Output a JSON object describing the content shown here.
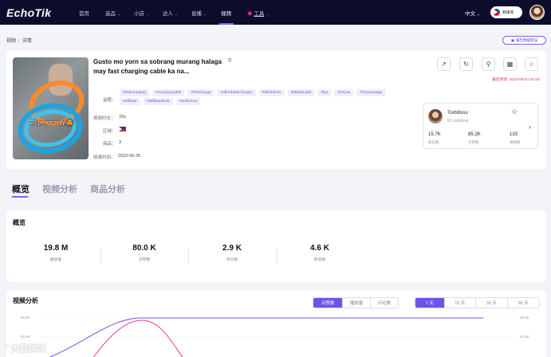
{
  "app": {
    "logo": "EchoTik"
  },
  "nav": {
    "items": [
      {
        "label": "首页"
      },
      {
        "label": "选品",
        "chevron": true
      },
      {
        "label": "小店",
        "chevron": true
      },
      {
        "label": "达人",
        "chevron": true
      },
      {
        "label": "直播",
        "chevron": true
      },
      {
        "label": "视频",
        "active": true
      },
      {
        "label": "工具",
        "chevron": true
      }
    ],
    "language": "中文",
    "country_pill": "菲律宾"
  },
  "breadcrumb": {
    "parent": "视频",
    "current": "详情"
  },
  "report_button": "报告数据错误",
  "video": {
    "title": "Gusto mo yorn sa sobrang murang halaga may fast charging cable ka na...",
    "thumbnail_caption": "20 pesos only!😍",
    "topics_label": "话题：",
    "tags": [
      "#fastcharging",
      "#chargingcable",
      "#fastcharge",
      "#affordablecharger",
      "#tiktokfinds",
      "#tiktokbudol",
      "#fyp",
      "#foryou",
      "#foryourpage",
      "#affiliate",
      "#affiliatetiktok",
      "#ordernow"
    ],
    "duration_label": "视频时长：",
    "duration": "33s",
    "region_label": "区域：",
    "products_label": "商品：",
    "products": "3",
    "collected_label": "收录时间：",
    "collected": "2023-06-25",
    "updated": "最后更新: 2023-08-01 00:00"
  },
  "creator": {
    "name": "Torbitsss",
    "verified_mark": "♡",
    "id": "ID: torbitsss",
    "stats": [
      {
        "value": "15.7K",
        "label": "粉丝数"
      },
      {
        "value": "85.2K",
        "label": "点赞数"
      },
      {
        "value": "133",
        "label": "视频数"
      }
    ]
  },
  "tabs": [
    {
      "label": "概览",
      "active": true
    },
    {
      "label": "视频分析"
    },
    {
      "label": "商品分析"
    }
  ],
  "overview": {
    "title": "概览",
    "metrics": [
      {
        "value": "19.8 M",
        "label": "播放量"
      },
      {
        "value": "80.0 K",
        "label": "点赞数"
      },
      {
        "value": "2.9 K",
        "label": "评论数"
      },
      {
        "value": "4.6 K",
        "label": "转发数"
      }
    ]
  },
  "analysis": {
    "title": "视频分析",
    "metric_tabs": [
      "点赞数",
      "播放量",
      "评论数"
    ],
    "metric_active": 0,
    "range_tabs": [
      "7 天",
      "15 天",
      "30 天",
      "90 天"
    ],
    "range_active": 0,
    "y_left": [
      "80.0K",
      "60.0K"
    ],
    "y_right": [
      "30.0K",
      "22.5K"
    ]
  },
  "watermark": "大数跨境",
  "colors": {
    "accent": "#6a55e8",
    "nav_bg": "#0d0c2c",
    "pink_line": "#e9388f"
  }
}
